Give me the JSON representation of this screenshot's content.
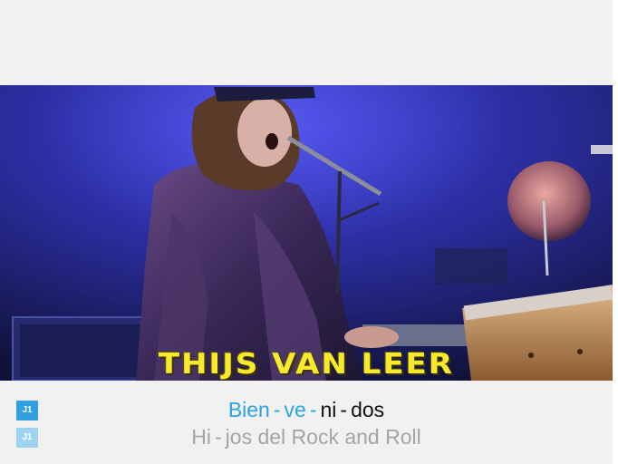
{
  "video": {
    "caption": "THIJS VAN LEER"
  },
  "lyrics": {
    "current_line": {
      "badge": "J1",
      "syllables": [
        {
          "text": "Bien",
          "state": "sung"
        },
        {
          "text": "-",
          "state": "sung"
        },
        {
          "text": "ve",
          "state": "sung"
        },
        {
          "text": "-",
          "state": "sung"
        },
        {
          "text": "ni",
          "state": "unsung"
        },
        {
          "text": "-",
          "state": "unsung"
        },
        {
          "text": "dos",
          "state": "unsung"
        }
      ]
    },
    "next_line": {
      "badge": "J1",
      "syllables": [
        {
          "text": "Hi",
          "state": "next"
        },
        {
          "text": "-",
          "state": "next"
        },
        {
          "text": "jos del Rock and Roll",
          "state": "next"
        }
      ]
    }
  },
  "colors": {
    "sung": "#2aa3e6",
    "unsung": "#111111",
    "next": "#a4a4a4",
    "caption": "#f7ea2e",
    "badge_active": "#2f9fe0",
    "badge_next": "#9fd3f2"
  }
}
